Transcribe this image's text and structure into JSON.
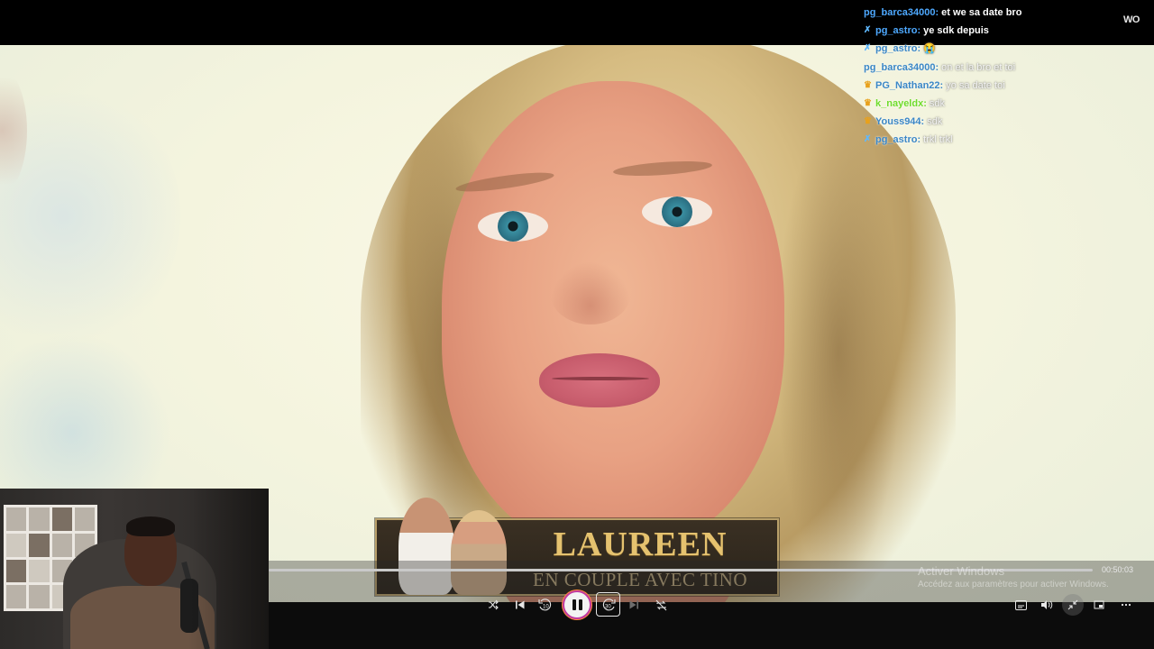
{
  "chat": {
    "messages": [
      {
        "badge": "",
        "user": "pg_barca34000:",
        "text": "et we sa date bro",
        "faded": false
      },
      {
        "badge": "sword",
        "user": "pg_astro:",
        "text": "ye sdk depuis",
        "faded": false
      },
      {
        "badge": "sword",
        "user": "pg_astro:",
        "text": "😭",
        "faded": true
      },
      {
        "badge": "",
        "user": "pg_barca34000:",
        "text": "on et la bro et toi",
        "faded": true
      },
      {
        "badge": "crown",
        "user": "PG_Nathan22:",
        "text": "yo sa date toi",
        "faded": true
      },
      {
        "badge": "crown",
        "user": "k_nayeldx:",
        "text": "sdk",
        "faded": true,
        "green": true
      },
      {
        "badge": "crown",
        "user": "Youss944:",
        "text": "sdk",
        "faded": true
      },
      {
        "badge": "sword",
        "user": "pg_astro:",
        "text": "trkl trkl",
        "faded": true
      }
    ]
  },
  "logo": "WO",
  "banner": {
    "name": "LAUREEN",
    "subtitle": "EN COUPLE AVEC TINO"
  },
  "player": {
    "current_time": "00:50:03",
    "progress": 1.0,
    "skip_back_seconds": "10",
    "skip_forward_seconds": "30",
    "icons": {
      "shuffle": "shuffle-icon",
      "previous": "previous-icon",
      "rewind": "rewind-10-icon",
      "pause": "pause-icon",
      "forward": "forward-30-icon",
      "next": "next-icon",
      "repeat": "repeat-off-icon",
      "subtitles": "subtitles-icon",
      "volume": "volume-icon",
      "mini": "mini-player-icon",
      "fullscreen": "fullscreen-icon",
      "more": "more-icon"
    }
  },
  "watermark": {
    "line1": "Activer Windows",
    "line2": "Accédez aux paramètres pour activer Windows."
  },
  "colors": {
    "chat_user": "#4ea9ff",
    "accent_play_border": "#c03aa0",
    "banner_gold": "#e5c26f"
  }
}
